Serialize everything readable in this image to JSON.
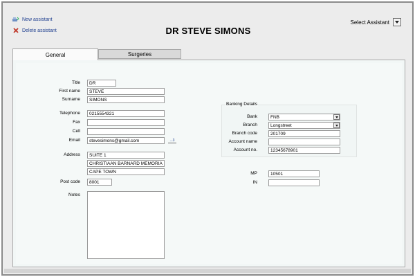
{
  "actions": {
    "new_assistant": "New assistant",
    "delete_assistant": "Delete assistant"
  },
  "title": "DR STEVE SIMONS",
  "select_assistant": {
    "label": "Select Assistant"
  },
  "tabs": [
    {
      "label": "General",
      "active": true
    },
    {
      "label": "Surgeries",
      "active": false
    }
  ],
  "personal": {
    "title": {
      "label": "Title",
      "value": "DR"
    },
    "first_name": {
      "label": "First name",
      "value": "STEVE"
    },
    "surname": {
      "label": "Surname",
      "value": "SIMONS"
    },
    "telephone": {
      "label": "Telephone",
      "value": "0215554321"
    },
    "fax": {
      "label": "Fax",
      "value": ""
    },
    "cell": {
      "label": "Cell",
      "value": ""
    },
    "email": {
      "label": "Email",
      "value": "stevesimons@gmail.com",
      "button": "...3"
    },
    "address": {
      "label": "Address",
      "lines": [
        "SUITE 1",
        "CHRISTIAAN BARNARD MEMORIAL",
        "CAPE TOWN"
      ]
    },
    "post_code": {
      "label": "Post code",
      "value": "8001"
    },
    "notes": {
      "label": "Notes",
      "value": ""
    }
  },
  "banking": {
    "heading": "Banking Details",
    "bank": {
      "label": "Bank",
      "value": "FNB"
    },
    "branch": {
      "label": "Branch",
      "value": "Longstreet"
    },
    "branch_code": {
      "label": "Branch code",
      "value": "201709"
    },
    "account_name": {
      "label": "Account name",
      "value": ""
    },
    "account_no": {
      "label": "Account no.",
      "value": "12345678901"
    }
  },
  "registration": {
    "mp": {
      "label": "MP",
      "value": "10501"
    },
    "in": {
      "label": "IN",
      "value": ""
    }
  },
  "colors": {
    "link": "#1f3f8f",
    "delete_icon": "#c0392b",
    "panel_bg": "#f2f7f6"
  }
}
